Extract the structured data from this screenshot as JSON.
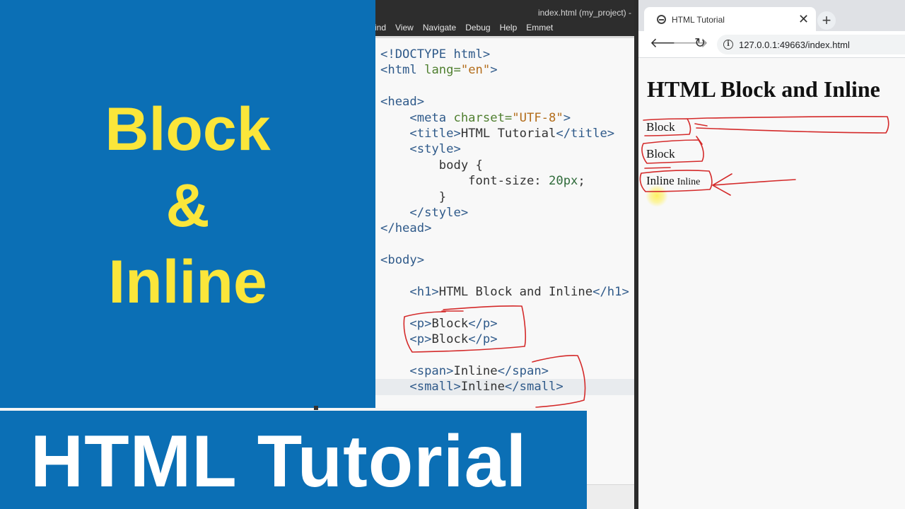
{
  "promo": {
    "line1": "Block",
    "line2": "&",
    "line3": "Inline",
    "text_color": "#fbe63a",
    "bg_color": "#0b6fb5"
  },
  "editor": {
    "title": "index.html (my_project) -",
    "menu": [
      "ind",
      "View",
      "Navigate",
      "Debug",
      "Help",
      "Emmet"
    ],
    "code": {
      "l1": "<!DOCTYPE html>",
      "l2_open": "<html",
      "l2_attr": " lang=",
      "l2_val": "\"en\"",
      "l2_close": ">",
      "l4": "<head>",
      "l5_open": "    <meta",
      "l5_attr": " charset=",
      "l5_val": "\"UTF-8\"",
      "l5_close": ">",
      "l6_open": "    <title>",
      "l6_text": "HTML Tutorial",
      "l6_close": "</title>",
      "l7": "    <style>",
      "l8": "        body {",
      "l9_prop": "            font-size: ",
      "l9_val": "20px",
      "l9_end": ";",
      "l10": "        }",
      "l11": "    </style>",
      "l12": "</head>",
      "l14": "<body>",
      "l16_open": "    <h1>",
      "l16_text": "HTML Block and Inline",
      "l16_close": "</h1>",
      "l18_open": "    <p>",
      "l18_text": "Block",
      "l18_close": "</p>",
      "l19_open": "    <p>",
      "l19_text": "Block",
      "l19_close": "</p>",
      "l21_open": "    <span>",
      "l21_text": "Inline",
      "l21_close": "</span>",
      "l22_open": "    <small>",
      "l22_text": "Inline",
      "l22_close": "</small>"
    }
  },
  "browser": {
    "tab_title": "HTML Tutorial",
    "tab_close": "✕",
    "new_tab": "+",
    "url": "127.0.0.1:49663/index.html",
    "page": {
      "h1": "HTML Block and Inline",
      "p1": "Block",
      "p2": "Block",
      "span": "Inline",
      "small": "Inline"
    }
  },
  "banner": {
    "title": "HTML Tutorial",
    "bg_color": "#0b6fb5"
  },
  "annotation_color": "#d42a2a"
}
